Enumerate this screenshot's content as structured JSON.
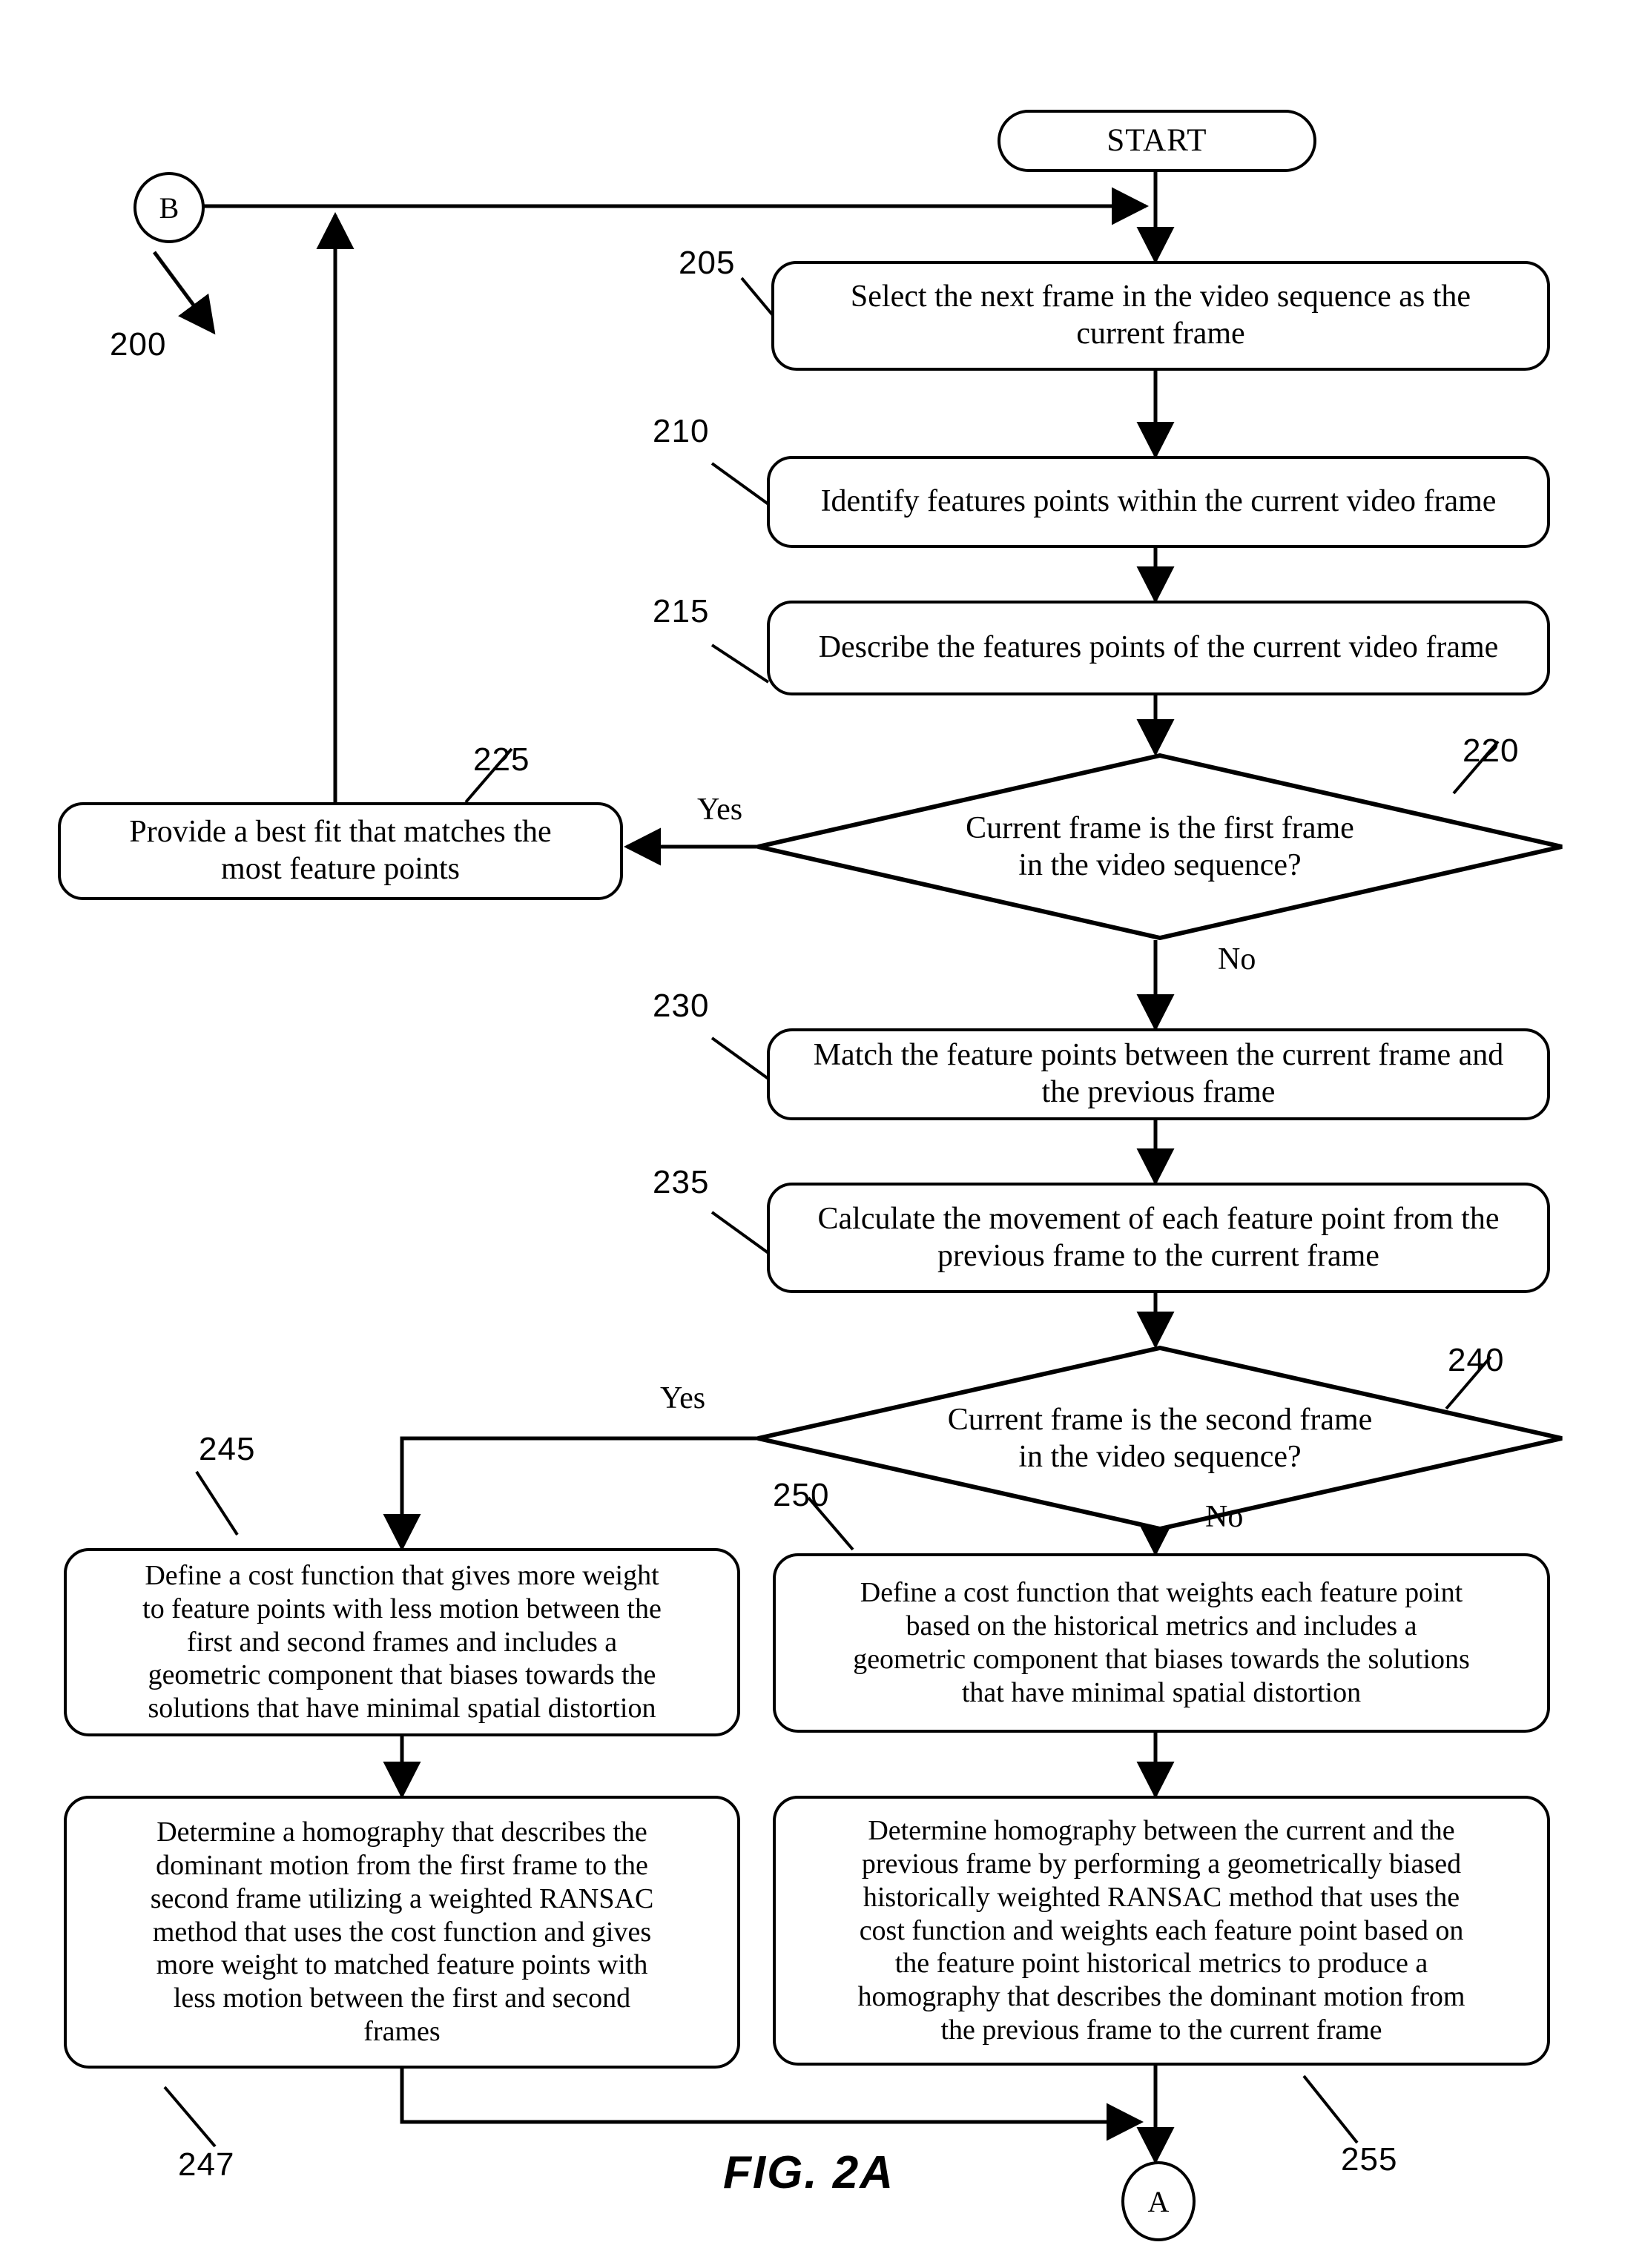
{
  "figure": {
    "label": "FIG. 2A",
    "diagram_ref": "200"
  },
  "connectors": {
    "entry_b": "B",
    "exit_a": "A"
  },
  "terminals": {
    "start": "START"
  },
  "edge_labels": {
    "yes_220": "Yes",
    "no_220": "No",
    "yes_240": "Yes",
    "no_240": "No"
  },
  "refs": {
    "r200": "200",
    "r205": "205",
    "r210": "210",
    "r215": "215",
    "r220": "220",
    "r225": "225",
    "r230": "230",
    "r235": "235",
    "r240": "240",
    "r245": "245",
    "r247": "247",
    "r250": "250",
    "r255": "255"
  },
  "nodes": {
    "n205": {
      "ref": "205",
      "type": "process",
      "text": "Select the next frame in the video sequence as the\ncurrent frame"
    },
    "n210": {
      "ref": "210",
      "type": "process",
      "text": "Identify features points within the current video frame"
    },
    "n215": {
      "ref": "215",
      "type": "process",
      "text": "Describe the features points of the current video frame"
    },
    "n220": {
      "ref": "220",
      "type": "decision",
      "text": "Current frame is the first frame\nin the video sequence?"
    },
    "n225": {
      "ref": "225",
      "type": "process",
      "text": "Provide a best fit that matches the\nmost feature points"
    },
    "n230": {
      "ref": "230",
      "type": "process",
      "text": "Match the feature points between the current frame and\nthe previous frame"
    },
    "n235": {
      "ref": "235",
      "type": "process",
      "text": "Calculate the movement of each feature point from the\nprevious frame to the current frame"
    },
    "n240": {
      "ref": "240",
      "type": "decision",
      "text": "Current frame is the second frame\nin the video sequence?"
    },
    "n245": {
      "ref": "245",
      "type": "process",
      "text": "Define a cost function that gives more weight\nto feature points with less motion between the\nfirst and second frames  and includes a\ngeometric component that biases towards the\nsolutions that have minimal spatial distortion"
    },
    "n247": {
      "ref": "247",
      "type": "process",
      "text": "Determine a homography that describes the\ndominant motion from the first frame to the\nsecond frame utilizing a weighted RANSAC\nmethod that uses the cost function and gives\nmore weight to matched feature points with\nless motion between the first and second\nframes"
    },
    "n250": {
      "ref": "250",
      "type": "process",
      "text": "Define a cost function that weights each feature point\nbased on the historical metrics and includes a\ngeometric component that biases towards the solutions\nthat have minimal spatial distortion"
    },
    "n255": {
      "ref": "255",
      "type": "process",
      "text": "Determine homography between the current and the\nprevious frame by performing a geometrically biased\nhistorically weighted RANSAC method that uses the\ncost function and weights each feature point based on\nthe feature point historical metrics to produce a\nhomography that describes the dominant motion from\nthe previous frame to the current frame"
    }
  },
  "colors": {
    "stroke": "#000000",
    "background": "#ffffff"
  }
}
